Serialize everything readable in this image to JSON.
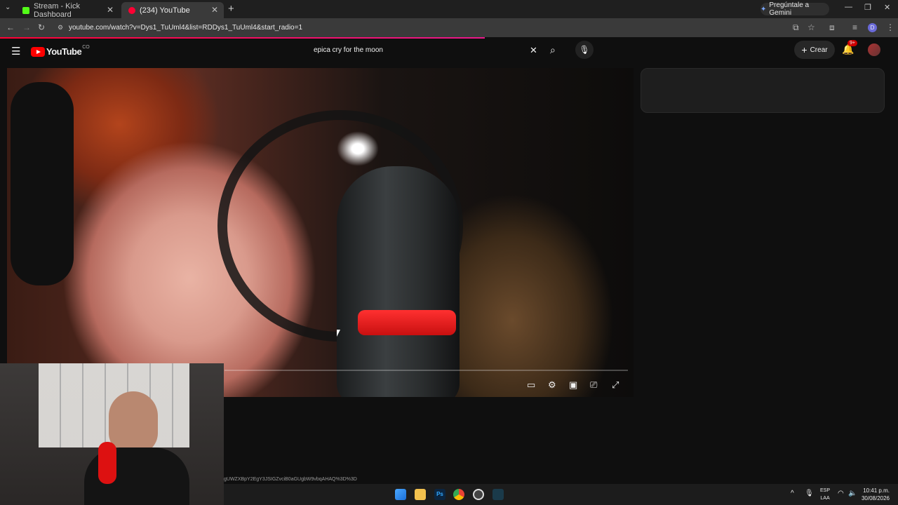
{
  "browser": {
    "tabs": [
      {
        "label": "Stream - Kick Dashboard",
        "favicon_color": "#53fc18"
      },
      {
        "label": "(234) YouTube",
        "favicon_color": "#ff0033"
      }
    ],
    "gemini_label": "Pregúntale a Gemini",
    "url": "youtube.com/watch?v=Dys1_TuUml4&list=RDDys1_TuUml4&start_radio=1",
    "profile_letter": "D",
    "page_load_progress": 0.54
  },
  "youtube": {
    "logo_text": "YouTube",
    "logo_country": "CO",
    "search_value": "epica cry for the moon",
    "create_label": "Crear",
    "notification_count": "9+"
  },
  "status_url": "gUWZXBpY2EgY3JSIGZvciB0aGUgbW9vbqAHAQ%3D%3D",
  "taskbar": {
    "lang_line1": "ESP",
    "lang_line2": "LAA",
    "time": "10:41 p.m.",
    "date": "30/08/2026"
  },
  "icons": [
    "menu-icon",
    "search-icon",
    "clear-icon",
    "mic-icon",
    "bell-icon",
    "subtitles-icon",
    "settings-icon",
    "miniplayer-icon",
    "cast-icon",
    "fullscreen-icon"
  ],
  "colors": {
    "accent": "#ff0000",
    "progress": "#e8188a"
  }
}
